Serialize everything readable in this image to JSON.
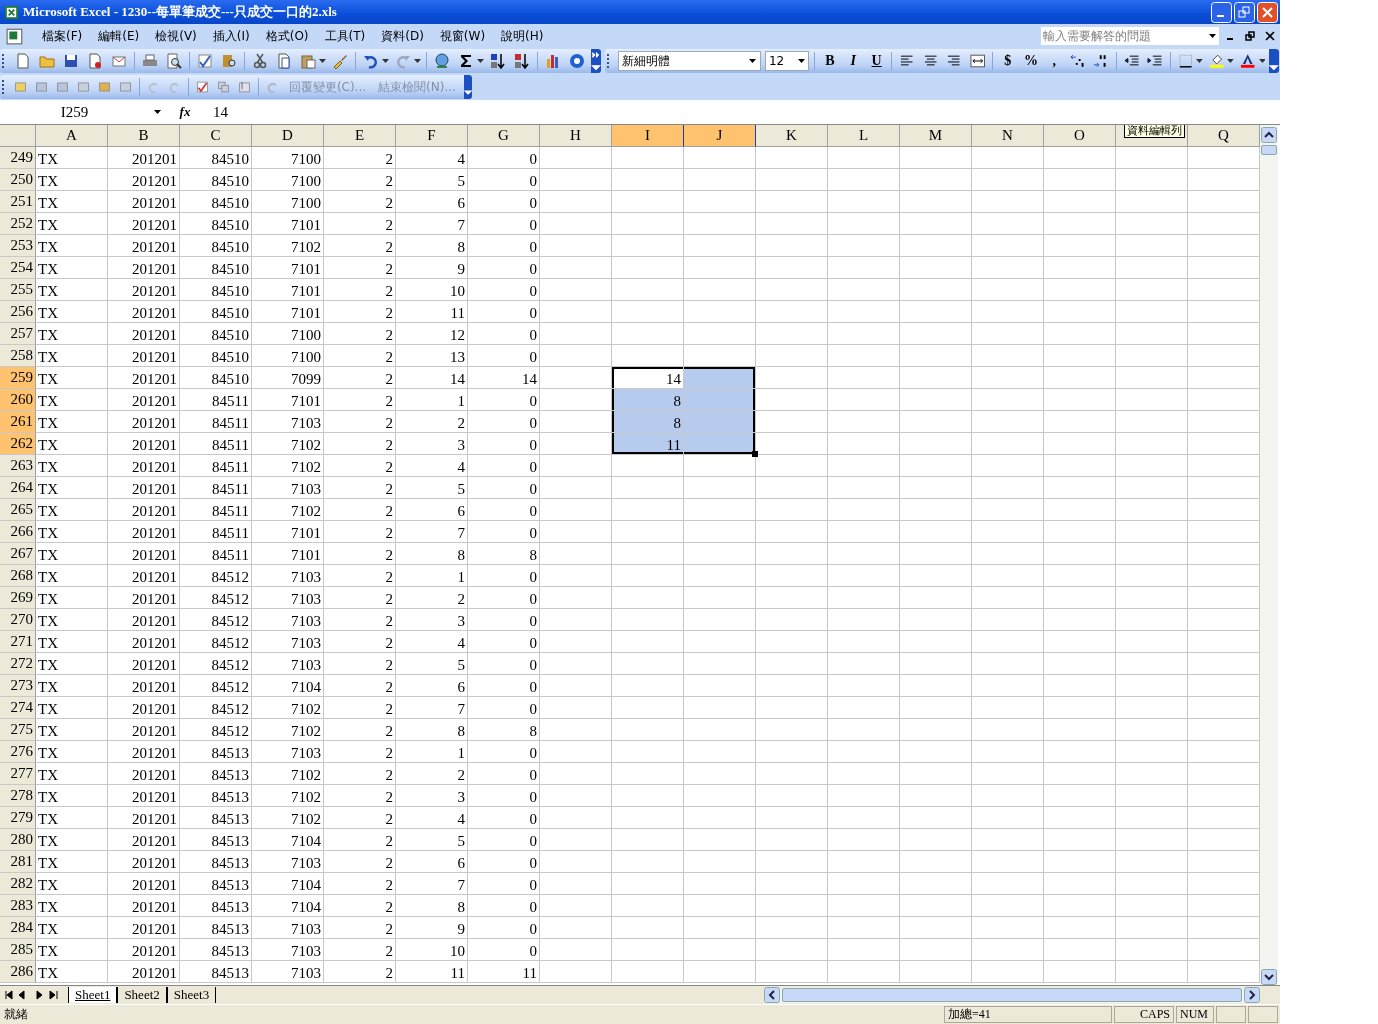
{
  "window": {
    "title": "Microsoft Excel - 1230--每單筆成交---只成交一口的2.xls"
  },
  "menu": [
    "檔案(F)",
    "編輯(E)",
    "檢視(V)",
    "插入(I)",
    "格式(O)",
    "工具(T)",
    "資料(D)",
    "視窗(W)",
    "說明(H)"
  ],
  "help_box": {
    "placeholder": "輸入需要解答的問題"
  },
  "format_toolbar": {
    "font": "新細明體",
    "size": "12",
    "bold": "B",
    "italic": "I",
    "underline": "U",
    "currency": "$",
    "percent": "%",
    "comma": ","
  },
  "review_toolbar": [
    "回覆變更(C)...",
    "結束檢閱(N)..."
  ],
  "formula_bar": {
    "name_box": "I259",
    "fx": "fx",
    "value": "14"
  },
  "columns": [
    {
      "label": "A",
      "selected": false
    },
    {
      "label": "B",
      "selected": false
    },
    {
      "label": "C",
      "selected": false
    },
    {
      "label": "D",
      "selected": false
    },
    {
      "label": "E",
      "selected": false
    },
    {
      "label": "F",
      "selected": false
    },
    {
      "label": "G",
      "selected": false
    },
    {
      "label": "H",
      "selected": false
    },
    {
      "label": "I",
      "selected": true
    },
    {
      "label": "J",
      "selected": true
    },
    {
      "label": "K",
      "selected": false
    },
    {
      "label": "L",
      "selected": false
    },
    {
      "label": "M",
      "selected": false
    },
    {
      "label": "N",
      "selected": false
    },
    {
      "label": "O",
      "selected": false
    },
    {
      "selected": false
    },
    {
      "label": "Q",
      "selected": false
    }
  ],
  "tooltip": "資料編輯列",
  "rows": [
    {
      "n": "249",
      "selected": false,
      "cells": [
        "TX",
        "201201",
        "84510",
        "7100",
        "2",
        "4",
        "0"
      ]
    },
    {
      "n": "250",
      "selected": false,
      "cells": [
        "TX",
        "201201",
        "84510",
        "7100",
        "2",
        "5",
        "0"
      ]
    },
    {
      "n": "251",
      "selected": false,
      "cells": [
        "TX",
        "201201",
        "84510",
        "7100",
        "2",
        "6",
        "0"
      ]
    },
    {
      "n": "252",
      "selected": false,
      "cells": [
        "TX",
        "201201",
        "84510",
        "7101",
        "2",
        "7",
        "0"
      ]
    },
    {
      "n": "253",
      "selected": false,
      "cells": [
        "TX",
        "201201",
        "84510",
        "7102",
        "2",
        "8",
        "0"
      ]
    },
    {
      "n": "254",
      "selected": false,
      "cells": [
        "TX",
        "201201",
        "84510",
        "7101",
        "2",
        "9",
        "0"
      ]
    },
    {
      "n": "255",
      "selected": false,
      "cells": [
        "TX",
        "201201",
        "84510",
        "7101",
        "2",
        "10",
        "0"
      ]
    },
    {
      "n": "256",
      "selected": false,
      "cells": [
        "TX",
        "201201",
        "84510",
        "7101",
        "2",
        "11",
        "0"
      ]
    },
    {
      "n": "257",
      "selected": false,
      "cells": [
        "TX",
        "201201",
        "84510",
        "7100",
        "2",
        "12",
        "0"
      ]
    },
    {
      "n": "258",
      "selected": false,
      "cells": [
        "TX",
        "201201",
        "84510",
        "7100",
        "2",
        "13",
        "0"
      ]
    },
    {
      "n": "259",
      "selected": true,
      "active": true,
      "cells": [
        "TX",
        "201201",
        "84510",
        "7099",
        "2",
        "14",
        "14"
      ],
      "column_i": "14"
    },
    {
      "n": "260",
      "selected": true,
      "active": false,
      "cells": [
        "TX",
        "201201",
        "84511",
        "7101",
        "2",
        "1",
        "0"
      ],
      "column_i": "8"
    },
    {
      "n": "261",
      "selected": true,
      "active": false,
      "cells": [
        "TX",
        "201201",
        "84511",
        "7103",
        "2",
        "2",
        "0"
      ],
      "column_i": "8"
    },
    {
      "n": "262",
      "selected": true,
      "active": false,
      "cells": [
        "TX",
        "201201",
        "84511",
        "7102",
        "2",
        "3",
        "0"
      ],
      "column_i": "11"
    },
    {
      "n": "263",
      "selected": false,
      "cells": [
        "TX",
        "201201",
        "84511",
        "7102",
        "2",
        "4",
        "0"
      ]
    },
    {
      "n": "264",
      "selected": false,
      "cells": [
        "TX",
        "201201",
        "84511",
        "7103",
        "2",
        "5",
        "0"
      ]
    },
    {
      "n": "265",
      "selected": false,
      "cells": [
        "TX",
        "201201",
        "84511",
        "7102",
        "2",
        "6",
        "0"
      ]
    },
    {
      "n": "266",
      "selected": false,
      "cells": [
        "TX",
        "201201",
        "84511",
        "7101",
        "2",
        "7",
        "0"
      ]
    },
    {
      "n": "267",
      "selected": false,
      "cells": [
        "TX",
        "201201",
        "84511",
        "7101",
        "2",
        "8",
        "8"
      ]
    },
    {
      "n": "268",
      "selected": false,
      "cells": [
        "TX",
        "201201",
        "84512",
        "7103",
        "2",
        "1",
        "0"
      ]
    },
    {
      "n": "269",
      "selected": false,
      "cells": [
        "TX",
        "201201",
        "84512",
        "7103",
        "2",
        "2",
        "0"
      ]
    },
    {
      "n": "270",
      "selected": false,
      "cells": [
        "TX",
        "201201",
        "84512",
        "7103",
        "2",
        "3",
        "0"
      ]
    },
    {
      "n": "271",
      "selected": false,
      "cells": [
        "TX",
        "201201",
        "84512",
        "7103",
        "2",
        "4",
        "0"
      ]
    },
    {
      "n": "272",
      "selected": false,
      "cells": [
        "TX",
        "201201",
        "84512",
        "7103",
        "2",
        "5",
        "0"
      ]
    },
    {
      "n": "273",
      "selected": false,
      "cells": [
        "TX",
        "201201",
        "84512",
        "7104",
        "2",
        "6",
        "0"
      ]
    },
    {
      "n": "274",
      "selected": false,
      "cells": [
        "TX",
        "201201",
        "84512",
        "7102",
        "2",
        "7",
        "0"
      ]
    },
    {
      "n": "275",
      "selected": false,
      "cells": [
        "TX",
        "201201",
        "84512",
        "7102",
        "2",
        "8",
        "8"
      ]
    },
    {
      "n": "276",
      "selected": false,
      "cells": [
        "TX",
        "201201",
        "84513",
        "7103",
        "2",
        "1",
        "0"
      ]
    },
    {
      "n": "277",
      "selected": false,
      "cells": [
        "TX",
        "201201",
        "84513",
        "7102",
        "2",
        "2",
        "0"
      ]
    },
    {
      "n": "278",
      "selected": false,
      "cells": [
        "TX",
        "201201",
        "84513",
        "7102",
        "2",
        "3",
        "0"
      ]
    },
    {
      "n": "279",
      "selected": false,
      "cells": [
        "TX",
        "201201",
        "84513",
        "7102",
        "2",
        "4",
        "0"
      ]
    },
    {
      "n": "280",
      "selected": false,
      "cells": [
        "TX",
        "201201",
        "84513",
        "7104",
        "2",
        "5",
        "0"
      ]
    },
    {
      "n": "281",
      "selected": false,
      "cells": [
        "TX",
        "201201",
        "84513",
        "7103",
        "2",
        "6",
        "0"
      ]
    },
    {
      "n": "282",
      "selected": false,
      "cells": [
        "TX",
        "201201",
        "84513",
        "7104",
        "2",
        "7",
        "0"
      ]
    },
    {
      "n": "283",
      "selected": false,
      "cells": [
        "TX",
        "201201",
        "84513",
        "7104",
        "2",
        "8",
        "0"
      ]
    },
    {
      "n": "284",
      "selected": false,
      "cells": [
        "TX",
        "201201",
        "84513",
        "7103",
        "2",
        "9",
        "0"
      ]
    },
    {
      "n": "285",
      "selected": false,
      "cells": [
        "TX",
        "201201",
        "84513",
        "7103",
        "2",
        "10",
        "0"
      ]
    },
    {
      "n": "286",
      "selected": false,
      "cells": [
        "TX",
        "201201",
        "84513",
        "7103",
        "2",
        "11",
        "11"
      ]
    }
  ],
  "sheet_tabs": [
    {
      "label": "Sheet1",
      "selected": true
    },
    {
      "label": "Sheet2",
      "selected": false
    },
    {
      "label": "Sheet3",
      "selected": false
    }
  ],
  "status_bar": {
    "status": "就緒",
    "sum": "加總=41",
    "caps": "CAPS",
    "num": "NUM"
  }
}
